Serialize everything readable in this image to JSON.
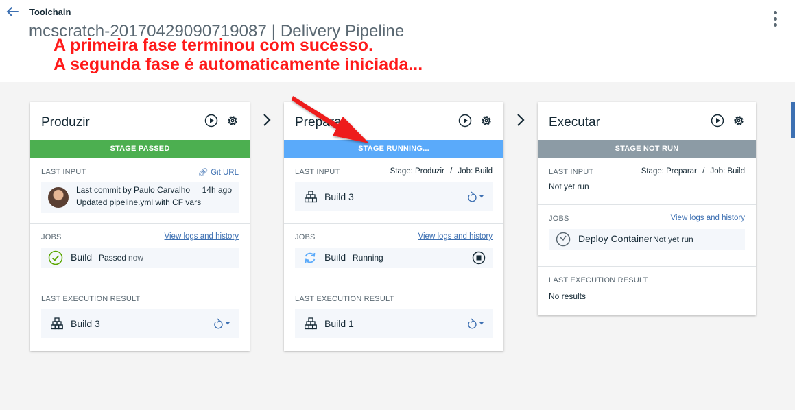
{
  "header": {
    "toolchain_label": "Toolchain",
    "title": "mcscratch-20170429090719087 | Delivery Pipeline"
  },
  "annotation": {
    "line1": "A primeira fase terminou com sucesso.",
    "line2": "A segunda fase é automaticamente iniciada..."
  },
  "colors": {
    "passed": "#5aa700",
    "running": "#5aaafa",
    "not_run": "#8c9ba5",
    "annotation": "#ff1a1a",
    "link": "#3d70b2"
  },
  "stages": [
    {
      "name": "Produzir",
      "status": "STAGE PASSED",
      "last_input_label": "LAST INPUT",
      "input_source": "Git URL",
      "commit_text": "Last commit by Paulo Carvalho",
      "commit_time": "14h ago",
      "commit_link": "Updated pipeline.yml with CF vars",
      "jobs_label": "JOBS",
      "view_logs": "View logs and history",
      "job_name": "Build",
      "job_status": "Passed",
      "job_time": "now",
      "result_label": "LAST EXECUTION RESULT",
      "result_build": "Build 3"
    },
    {
      "name": "Preparar",
      "status": "STAGE RUNNING...",
      "last_input_label": "LAST INPUT",
      "input_stage": "Stage: Produzir",
      "input_sep": "/",
      "input_job": "Job: Build",
      "input_build": "Build 3",
      "jobs_label": "JOBS",
      "view_logs": "View logs and history",
      "job_name": "Build",
      "job_status": "Running",
      "result_label": "LAST EXECUTION RESULT",
      "result_build": "Build 1"
    },
    {
      "name": "Executar",
      "status": "STAGE NOT RUN",
      "last_input_label": "LAST INPUT",
      "input_stage": "Stage: Preparar",
      "input_sep": "/",
      "input_job": "Job: Build",
      "input_value": "Not yet run",
      "jobs_label": "JOBS",
      "view_logs": "View logs and history",
      "job_name": "Deploy Container",
      "job_status": "Not yet run",
      "result_label": "LAST EXECUTION RESULT",
      "result_value": "No results"
    }
  ]
}
